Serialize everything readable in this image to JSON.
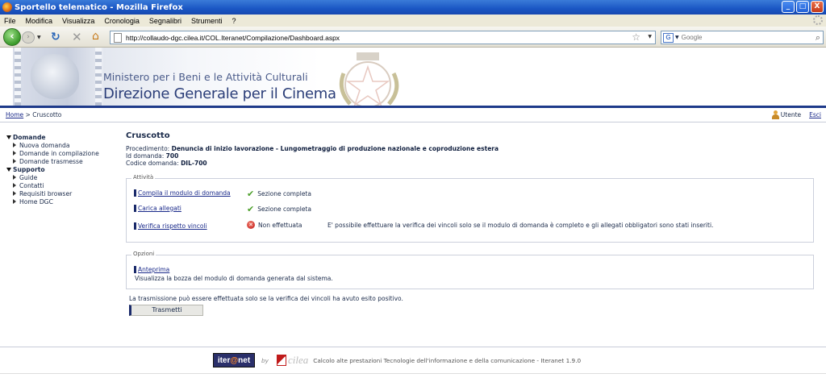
{
  "window": {
    "title": "Sportello telematico - Mozilla Firefox",
    "buttons": [
      "_",
      "□",
      "X"
    ]
  },
  "menu": [
    "File",
    "Modifica",
    "Visualizza",
    "Cronologia",
    "Segnalibri",
    "Strumenti",
    "?"
  ],
  "nav": {
    "url": "http://collaudo-dgc.cilea.it/COL.Iteranet/Compilazione/Dashboard.aspx",
    "search_placeholder": "Google",
    "search_engine_glyph": "G"
  },
  "banner": {
    "line1": "Ministero per i Beni e le Attività Culturali",
    "line2": "Direzione Generale per il Cinema"
  },
  "breadcrumb": {
    "home": "Home",
    "separator": ">",
    "current": "Cruscotto"
  },
  "user": {
    "name": "Utente",
    "logout": "Esci"
  },
  "sidebar": {
    "groups": [
      {
        "label": "Domande",
        "items": [
          "Nuova domanda",
          "Domande in compilazione",
          "Domande trasmesse"
        ]
      },
      {
        "label": "Supporto",
        "items": [
          "Guide",
          "Contatti",
          "Requisiti browser",
          "Home DGC"
        ]
      }
    ]
  },
  "main": {
    "title": "Cruscotto",
    "procedimento_label": "Procedimento:",
    "procedimento_value": "Denuncia di inizio lavorazione - Lungometraggio di produzione nazionale e coproduzione estera",
    "id_label": "Id domanda:",
    "id_value": "700",
    "codice_label": "Codice domanda:",
    "codice_value": "DIL-700",
    "attivita": {
      "legend": "Attività",
      "rows": [
        {
          "link": "Compila il modulo di domanda",
          "status": "Sezione completa",
          "status_icon": "check-icon"
        },
        {
          "link": "Carica allegati",
          "status": "Sezione completa",
          "status_icon": "check-icon"
        },
        {
          "link": "Verifica rispetto vincoli",
          "status": "Non effettuata",
          "status_icon": "error-icon",
          "note": "E' possibile effettuare la verifica dei vincoli solo se il modulo di domanda è completo e gli allegati obbligatori sono stati inseriti."
        }
      ]
    },
    "opzioni": {
      "legend": "Opzioni",
      "link": "Anteprima",
      "description": "Visualizza la bozza del modulo di domanda generata dal sistema."
    },
    "transmission_note": "La trasmissione può essere effettuata solo se la verifica dei vincoli ha avuto esito positivo.",
    "submit_label": "Trasmetti"
  },
  "footer": {
    "logo_text_a": "iter",
    "logo_text_at": "@",
    "logo_text_b": "net",
    "by": "by",
    "cilea_word": "cilea",
    "text": "Calcolo alte prestazioni Tecnologie dell'informazione e della comunicazione - Iteranet 1.9.0"
  },
  "colors": {
    "titlebar": "#1a56c4",
    "header_line": "#1e3a8a",
    "link": "#1a2a8a",
    "ok": "#4ca02a",
    "error": "#c01a1a"
  }
}
